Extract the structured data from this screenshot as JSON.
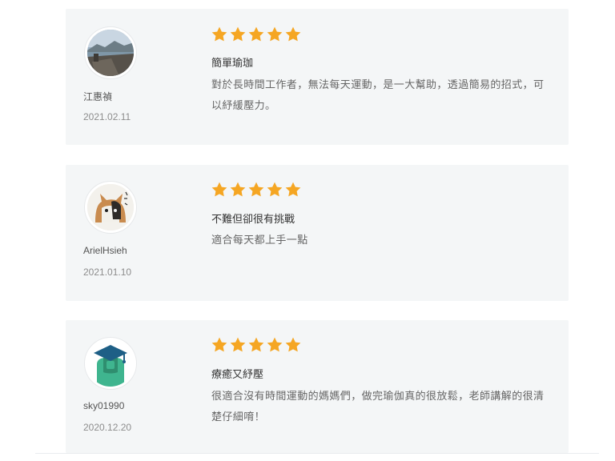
{
  "colors": {
    "card_bg": "#f4f6f7",
    "star": "#f5a623"
  },
  "reviews": [
    {
      "user": "江惠禎",
      "date": "2021.02.11",
      "rating": 5,
      "title": "簡單瑜珈",
      "body": "對於長時間工作者，無法每天運動，是一大幫助，透過簡易的招式，可以紓緩壓力。",
      "avatar": "landscape-photo"
    },
    {
      "user": "ArielHsieh",
      "date": "2021.01.10",
      "rating": 5,
      "title": "不難但卻很有挑戰",
      "body": "適合每天都上手一點",
      "avatar": "cat-photo"
    },
    {
      "user": "sky01990",
      "date": "2020.12.20",
      "rating": 5,
      "title": "療癒又紓壓",
      "body": "很適合沒有時間運動的媽媽們，做完瑜伽真的很放鬆，老師講解的很清楚仔細唷！",
      "avatar": "graduate-avatar"
    }
  ]
}
